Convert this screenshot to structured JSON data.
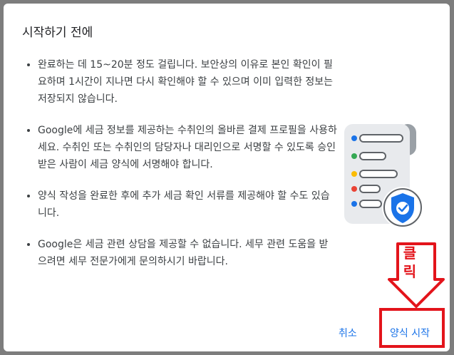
{
  "dialog": {
    "title": "시작하기 전에",
    "bullets": [
      "완료하는 데 15~20분 정도 걸립니다. 보안상의 이유로 본인 확인이 필요하며 1시간이 지나면 다시 확인해야 할 수 있으며 이미 입력한 정보는 저장되지 않습니다.",
      "Google에 세금 정보를 제공하는 수취인의 올바른 결제 프로필을 사용하세요. 수취인 또는 수취인의 담당자나 대리인으로 서명할 수 있도록 승인 받은 사람이 세금 양식에 서명해야 합니다.",
      "양식 작성을 완료한 후에 추가 세금 확인 서류를 제공해야 할 수도 있습니다.",
      "Google은 세금 관련 상담을 제공할 수 없습니다. 세무 관련 도움을 받으려면 세무 전문가에게 문의하시기 바랍니다."
    ],
    "cancel_label": "취소",
    "start_label": "양식 시작"
  },
  "annotation": {
    "click_label": "클릭",
    "color": "#e3141b"
  },
  "illustration": {
    "icon": "document-shield-icon",
    "dot_colors": [
      "#1a73e8",
      "#34a853",
      "#fbbc04",
      "#ea4335",
      "#1a73e8"
    ]
  }
}
